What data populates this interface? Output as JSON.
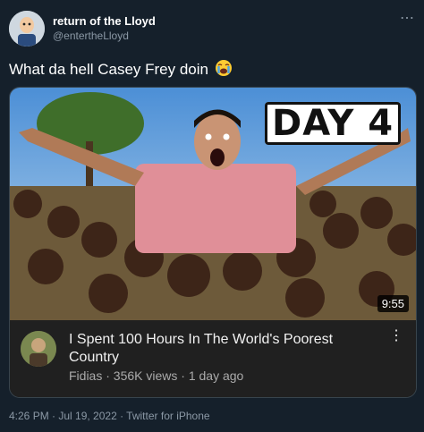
{
  "tweet": {
    "display_name": "return of the Lloyd",
    "handle": "@entertheLloyd",
    "more_icon": "⋯",
    "text": "What da hell Casey Frey doin",
    "emoji": "crying-face"
  },
  "video_card": {
    "thumbnail_badge": "DAY 4",
    "duration": "9:55",
    "title": "I Spent 100 Hours In The World's Poorest Country",
    "channel": "Fidias",
    "views_age": "Fidias · 356K views · 1 day ago",
    "menu_icon": "⋮"
  },
  "footer": {
    "meta": "4:26 PM · Jul 19, 2022 · Twitter for iPhone"
  }
}
